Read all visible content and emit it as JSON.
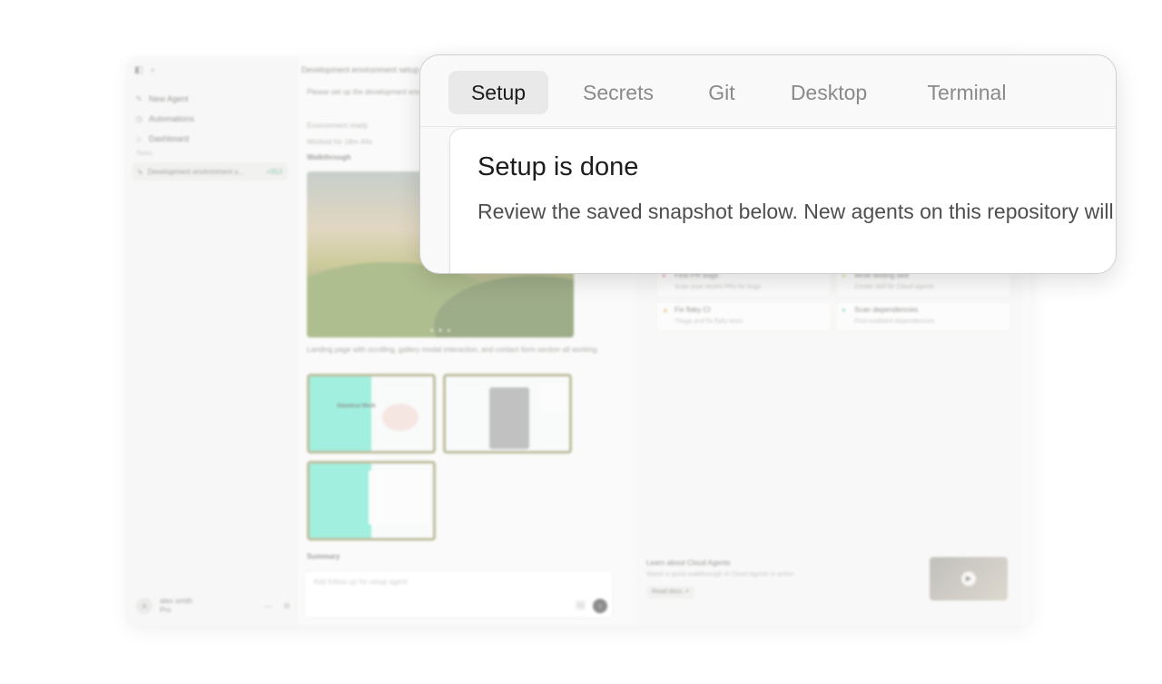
{
  "window": {
    "sidebar": {
      "items": [
        {
          "label": "New Agent",
          "icon": "compose-icon"
        },
        {
          "label": "Automations",
          "icon": "clock-icon"
        },
        {
          "label": "Dashboard",
          "icon": "home-icon"
        }
      ],
      "section_label": "Tasks",
      "task": {
        "label": "Development environment s...",
        "diff": "+953"
      },
      "user": {
        "initials": "A",
        "name": "alex smith",
        "plan": "Pro"
      }
    },
    "chat": {
      "title": "Development environment setup",
      "prompt": "Please set up the development environment for this application(s) and demonstrate...",
      "status_ready": "Environment ready",
      "worked_for": "Worked for 18m 44s",
      "walkthrough_label": "Walkthrough",
      "hero_dots": "● ♥ ●",
      "hero_caption": "Landing page with scrolling, gallery modal interaction, and contact form section all working.",
      "thumb1_text": "Standout Work",
      "summary_label": "Summary",
      "input_placeholder": "Add follow up for setup agent",
      "image_icon": "🖼",
      "send_icon": "↑"
    },
    "panel": {
      "actions": [
        {
          "title": "Find PR bugs",
          "sub": "Scan your recent PRs for bugs",
          "icon": "●",
          "color": "#e57373"
        },
        {
          "title": "Write testing skill",
          "sub": "Create skill for Cloud agents",
          "icon": "●",
          "color": "#e0b860"
        },
        {
          "title": "Fix flaky CI",
          "sub": "Triage and fix flaky tests",
          "icon": "▲",
          "color": "#e0a040"
        },
        {
          "title": "Scan dependencies",
          "sub": "Find outdated dependencies",
          "icon": "●",
          "color": "#4cc9a8"
        }
      ],
      "learn": {
        "title": "Learn about Cloud Agents",
        "subtitle": "Watch a quick walkthrough of Cloud Agents in action.",
        "button": "Read docs ↗",
        "play": "▶"
      }
    }
  },
  "callout": {
    "tabs": [
      {
        "label": "Setup",
        "active": true
      },
      {
        "label": "Secrets",
        "active": false
      },
      {
        "label": "Git",
        "active": false
      },
      {
        "label": "Desktop",
        "active": false
      },
      {
        "label": "Terminal",
        "active": false
      }
    ],
    "title": "Setup is done",
    "description": "Review the saved snapshot below. New agents on this repository will start from it."
  }
}
